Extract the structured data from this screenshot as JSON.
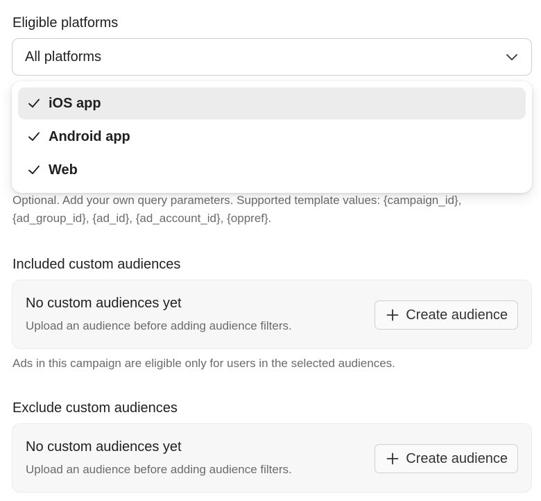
{
  "platforms": {
    "label": "Eligible platforms",
    "selected": "All platforms",
    "options": [
      {
        "label": "iOS app",
        "checked": true,
        "highlighted": true
      },
      {
        "label": "Android app",
        "checked": true
      },
      {
        "label": "Web",
        "checked": true
      }
    ]
  },
  "query_hint": "Optional. Add your own query parameters. Supported template values: {campaign_id}, {ad_group_id}, {ad_id}, {ad_account_id}, {oppref}.",
  "included": {
    "label": "Included custom audiences",
    "empty_title": "No custom audiences yet",
    "empty_sub": "Upload an audience before adding audience filters.",
    "button": "Create audience",
    "hint": "Ads in this campaign are eligible only for users in the selected audiences."
  },
  "excluded": {
    "label": "Exclude custom audiences",
    "empty_title": "No custom audiences yet",
    "empty_sub": "Upload an audience before adding audience filters.",
    "button": "Create audience"
  },
  "icons": {
    "select_chevron": "chevron-down-icon",
    "option_check": "check-icon",
    "button_plus": "plus-icon"
  }
}
